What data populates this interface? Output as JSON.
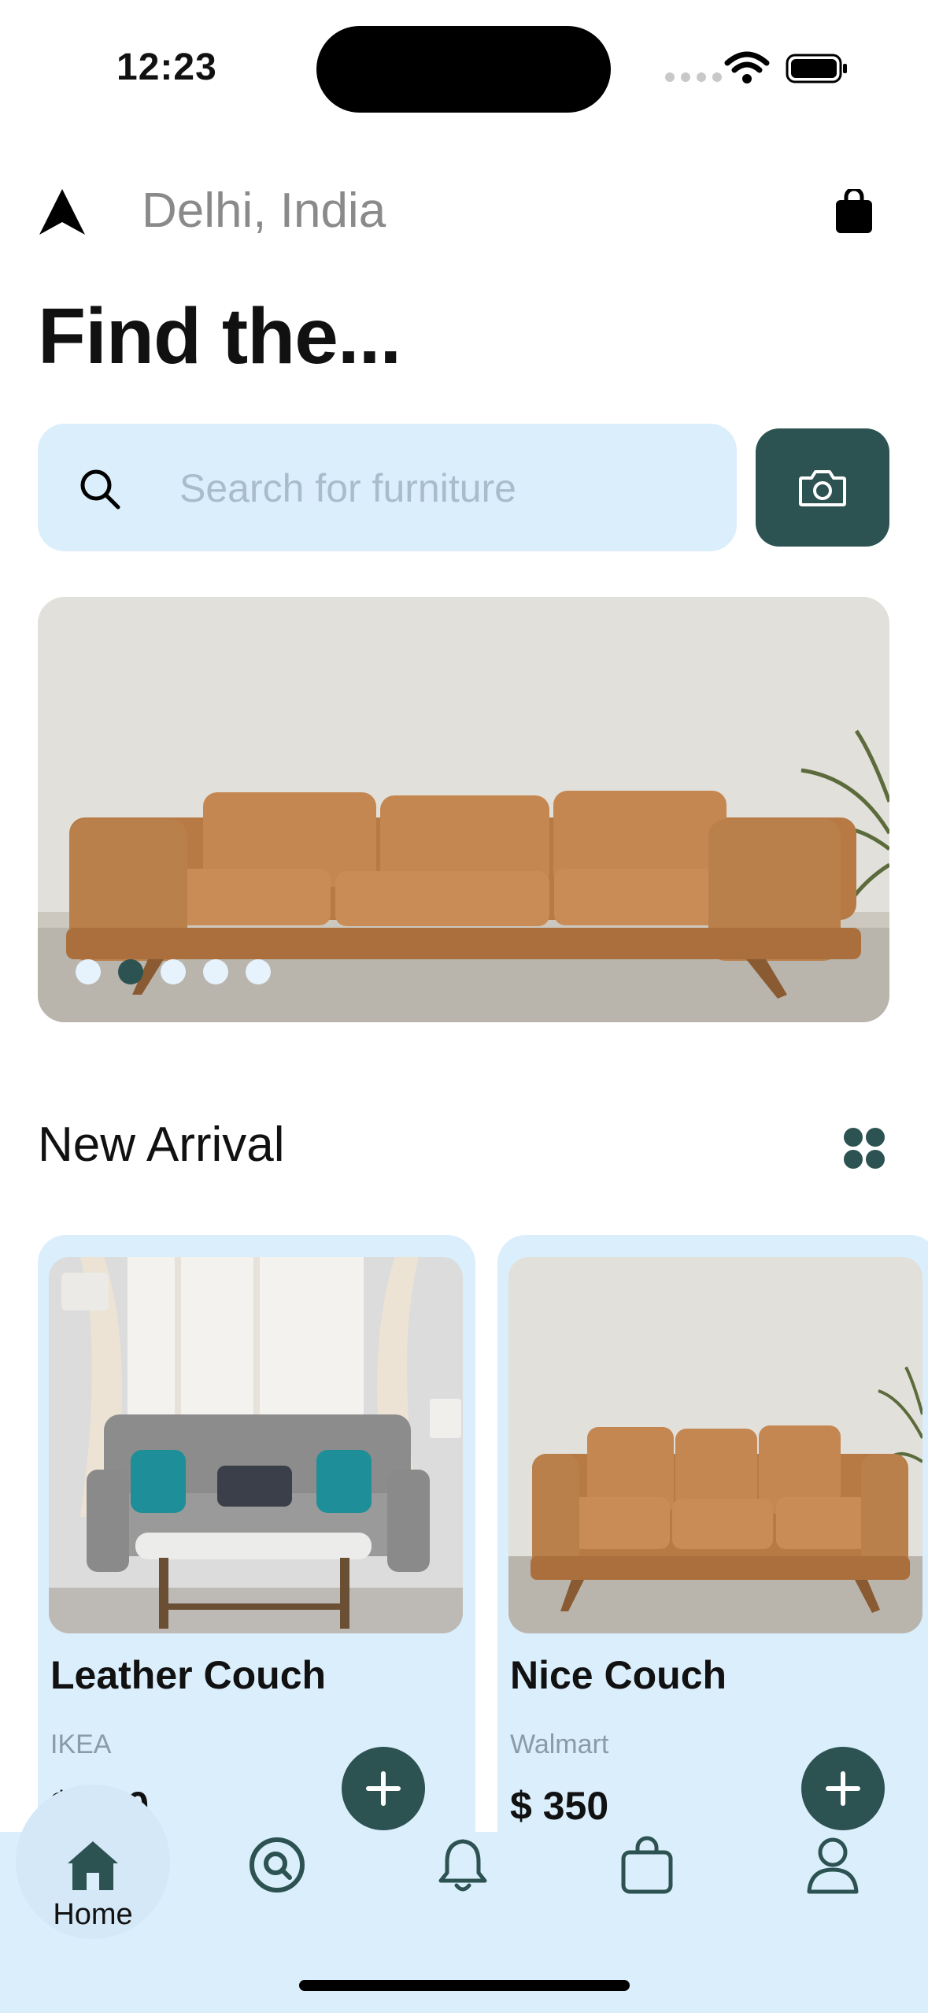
{
  "status_bar": {
    "time": "12:23"
  },
  "header": {
    "location": "Delhi, India",
    "headline": "Find the..."
  },
  "search": {
    "placeholder": "Search for furniture"
  },
  "carousel": {
    "dot_count": 5,
    "active_index": 1
  },
  "section": {
    "title": "New Arrival"
  },
  "products": [
    {
      "title": "Leather Couch",
      "brand": "IKEA",
      "price": "$ 350"
    },
    {
      "title": "Nice Couch",
      "brand": "Walmart",
      "price": "$ 350"
    }
  ],
  "tabbar": {
    "home_label": "Home"
  },
  "colors": {
    "accent": "#2c5252",
    "surface": "#dbeefc",
    "muted_text": "#8a8a8a"
  },
  "icons": [
    "navigation-arrow-icon",
    "shopping-bag-icon",
    "search-icon",
    "camera-icon",
    "grid-icon",
    "plus-icon",
    "home-icon",
    "discover-icon",
    "bell-icon",
    "bag-icon",
    "profile-icon"
  ]
}
